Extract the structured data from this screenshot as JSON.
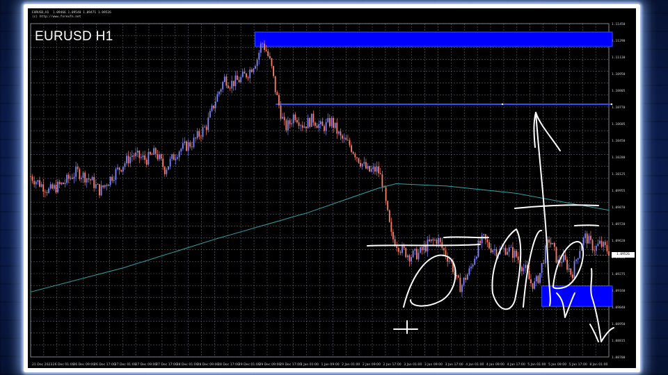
{
  "chart_header": {
    "symbol_title": "EURUSD H1",
    "info_line_1": "EURUSD,H1  1.09466 1.09540 1.09471 1.09526",
    "info_line_2": "(c) http://www.forexfn.net"
  },
  "colors": {
    "background": "#000000",
    "grid": "#5f6470",
    "bull_candle": "#7f86ff",
    "bear_candle": "#ff7f66",
    "moving_average": "#2fa6a8",
    "zone_fill": "#0000ff",
    "zone_border": "#3355ff",
    "annotation": "#ffffff"
  },
  "chart_data": {
    "type": "candlestick",
    "title": "EURUSD H1",
    "ylim": [
      0.0965,
      1.1145
    ],
    "y_ticks": [
      "1.11450",
      "1.11290",
      "1.11130",
      "1.10950",
      "1.10805",
      "1.10770",
      "1.10605",
      "1.10450",
      "1.10280",
      "1.10125",
      "1.09955",
      "1.09870",
      "1.09720",
      "1.09620",
      "1.09450",
      "1.09275",
      "1.09160",
      "1.09040",
      "1.08950",
      "1.08815",
      "1.08700"
    ],
    "x_ticks": [
      "21 Dec 2023",
      "26 Dec 01:00",
      "26 Dec 09:00",
      "26 Dec 17:00",
      "27 Dec 01:00",
      "27 Dec 09:00",
      "27 Dec 17:00",
      "28 Dec 01:00",
      "28 Dec 09:00",
      "28 Dec 17:00",
      "29 Dec 01:00",
      "29 Dec 09:00",
      "29 Dec 17:00",
      "1 Jan 01:00",
      "1 Jan 09:00",
      "2 Jan 01:00",
      "2 Jan 09:00",
      "2 Jan 17:00",
      "3 Jan 01:00",
      "3 Jan 09:00",
      "3 Jan 17:00",
      "4 Jan 01:00",
      "4 Jan 09:00",
      "4 Jan 17:00",
      "5 Jan 01:00",
      "5 Jan 09:00",
      "5 Jan 17:00",
      "8 Jan 01:00"
    ],
    "current_price": "1.09526",
    "price_path": [
      [
        0,
        1.1018
      ],
      [
        8,
        1.1006
      ],
      [
        14,
        1.1012
      ],
      [
        20,
        1.1022
      ],
      [
        26,
        1.1015
      ],
      [
        30,
        1.1006
      ],
      [
        36,
        1.102
      ],
      [
        44,
        1.1036
      ],
      [
        50,
        1.1032
      ],
      [
        54,
        1.1038
      ],
      [
        58,
        1.1024
      ],
      [
        64,
        1.104
      ],
      [
        70,
        1.1046
      ],
      [
        76,
        1.106
      ],
      [
        80,
        1.1082
      ],
      [
        84,
        1.11
      ],
      [
        86,
        1.1095
      ],
      [
        90,
        1.1098
      ],
      [
        94,
        1.1104
      ],
      [
        98,
        1.1116
      ],
      [
        100,
        1.113
      ],
      [
        102,
        1.1122
      ],
      [
        104,
        1.111
      ],
      [
        106,
        1.1088
      ],
      [
        108,
        1.1072
      ],
      [
        110,
        1.1058
      ],
      [
        112,
        1.1062
      ],
      [
        114,
        1.107
      ],
      [
        118,
        1.106
      ],
      [
        122,
        1.1066
      ],
      [
        126,
        1.1058
      ],
      [
        130,
        1.1064
      ],
      [
        134,
        1.105
      ],
      [
        138,
        1.1044
      ],
      [
        142,
        1.1032
      ],
      [
        146,
        1.1022
      ],
      [
        150,
        1.1024
      ],
      [
        152,
        1.1014
      ],
      [
        154,
        1.099
      ],
      [
        156,
        1.0968
      ],
      [
        160,
        1.0958
      ],
      [
        164,
        1.0952
      ],
      [
        168,
        1.0954
      ],
      [
        172,
        1.0962
      ],
      [
        176,
        1.0966
      ],
      [
        178,
        1.0958
      ],
      [
        182,
        1.0946
      ],
      [
        184,
        1.0932
      ],
      [
        186,
        1.0926
      ],
      [
        188,
        1.0934
      ],
      [
        190,
        1.094
      ],
      [
        192,
        1.0952
      ],
      [
        194,
        1.0962
      ],
      [
        196,
        1.0966
      ],
      [
        198,
        1.096
      ],
      [
        202,
        1.0956
      ],
      [
        206,
        1.0958
      ],
      [
        210,
        1.0952
      ],
      [
        212,
        1.0945
      ],
      [
        214,
        1.094
      ],
      [
        216,
        1.093
      ],
      [
        218,
        1.0928
      ],
      [
        220,
        1.0936
      ],
      [
        222,
        1.0952
      ],
      [
        224,
        1.0966
      ],
      [
        226,
        1.0958
      ],
      [
        228,
        1.0946
      ],
      [
        230,
        1.095
      ],
      [
        232,
        1.0944
      ],
      [
        234,
        1.0936
      ],
      [
        236,
        1.095
      ],
      [
        238,
        1.0962
      ],
      [
        240,
        1.0968
      ],
      [
        242,
        1.0962
      ],
      [
        244,
        1.0958
      ],
      [
        246,
        1.0962
      ],
      [
        250,
        1.0956
      ]
    ],
    "moving_average_path": [
      [
        0,
        1.0922
      ],
      [
        40,
        1.0942
      ],
      [
        80,
        1.0966
      ],
      [
        120,
        1.0988
      ],
      [
        150,
        1.1008
      ],
      [
        158,
        1.1012
      ],
      [
        180,
        1.101
      ],
      [
        210,
        1.1004
      ],
      [
        235,
        1.0995
      ],
      [
        250,
        1.099
      ]
    ],
    "supply_zone": {
      "y_top": 1.1138,
      "y_bottom": 1.1126
    },
    "demand_zone": {
      "y_top": 1.0927,
      "y_bottom": 1.091
    },
    "resistance_line": 1.1078,
    "annotations": {
      "up_arrow": "hand-drawn arrow pointing up from the resistance line",
      "down_arrows": "hand-drawn arrows pointing down toward the demand zone",
      "circles": "hand-drawn loops marking price swings",
      "horizontal_lines": "hand-drawn horizontal lines marking highs and lows"
    }
  }
}
